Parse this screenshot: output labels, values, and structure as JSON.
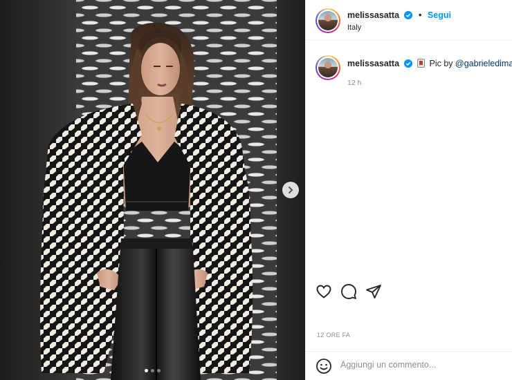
{
  "header": {
    "username": "melissasatta",
    "separator": "•",
    "follow_label": "Segui",
    "location": "Italy"
  },
  "caption": {
    "username": "melissasatta",
    "text_prefix": "Pic by ",
    "mention": "@gabrieledimart",
    "time_ago": "12 h"
  },
  "carousel": {
    "slide_count": 3,
    "active_slide": 1
  },
  "post": {
    "timestamp": "12 ORE FA"
  },
  "comment": {
    "placeholder": "Aggiungi un commento..."
  },
  "icons": {
    "verified": "verified-badge-icon",
    "like": "heart-icon",
    "comment": "comment-icon",
    "share": "paper-plane-icon",
    "emoji": "smiley-icon",
    "next": "chevron-right-icon"
  },
  "colors": {
    "link": "#0095f6",
    "mention": "#00376b",
    "verified": "#0095f6"
  }
}
